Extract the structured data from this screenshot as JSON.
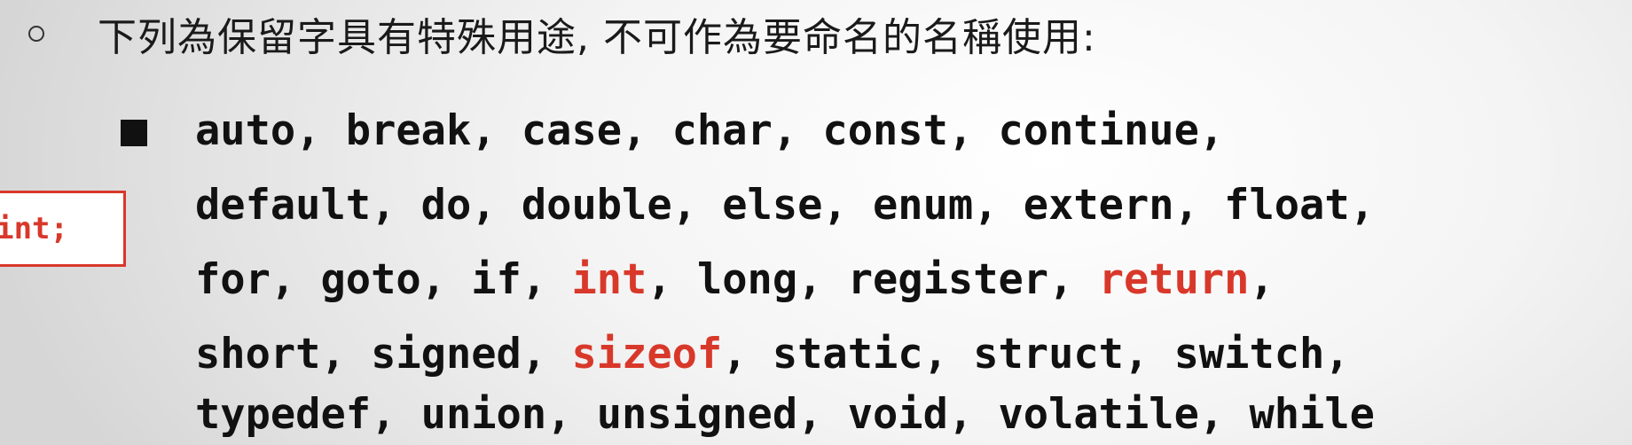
{
  "heading": {
    "text": "下列為保留字具有特殊用途, 不可作為要命名的名稱使用:"
  },
  "code_snippet": {
    "text": "int;"
  },
  "keyword_lines": [
    [
      {
        "word": "auto",
        "highlight": false
      },
      {
        "word": "break",
        "highlight": false
      },
      {
        "word": "case",
        "highlight": false
      },
      {
        "word": "char",
        "highlight": false
      },
      {
        "word": "const",
        "highlight": false
      },
      {
        "word": "continue",
        "highlight": false,
        "trailing": true
      }
    ],
    [
      {
        "word": "default",
        "highlight": false
      },
      {
        "word": "do",
        "highlight": false
      },
      {
        "word": "double",
        "highlight": false
      },
      {
        "word": "else",
        "highlight": false
      },
      {
        "word": "enum",
        "highlight": false
      },
      {
        "word": "extern",
        "highlight": false
      },
      {
        "word": "float",
        "highlight": false,
        "trailing": true
      }
    ],
    [
      {
        "word": "for",
        "highlight": false
      },
      {
        "word": "goto",
        "highlight": false
      },
      {
        "word": "if",
        "highlight": false
      },
      {
        "word": "int",
        "highlight": true
      },
      {
        "word": "long",
        "highlight": false
      },
      {
        "word": "register",
        "highlight": false
      },
      {
        "word": "return",
        "highlight": true,
        "trailing": true
      }
    ],
    [
      {
        "word": "short",
        "highlight": false
      },
      {
        "word": "signed",
        "highlight": false
      },
      {
        "word": "sizeof",
        "highlight": true
      },
      {
        "word": "static",
        "highlight": false
      },
      {
        "word": "struct",
        "highlight": false
      },
      {
        "word": "switch",
        "highlight": false,
        "trailing": true
      }
    ],
    [
      {
        "word": "typedef",
        "highlight": false
      },
      {
        "word": "union",
        "highlight": false
      },
      {
        "word": "unsigned",
        "highlight": false
      },
      {
        "word": "void",
        "highlight": false
      },
      {
        "word": "volatile",
        "highlight": false
      },
      {
        "word": "while",
        "highlight": false,
        "trailing": false
      }
    ]
  ],
  "colors": {
    "highlight": "#d8382a",
    "text": "#111111"
  }
}
